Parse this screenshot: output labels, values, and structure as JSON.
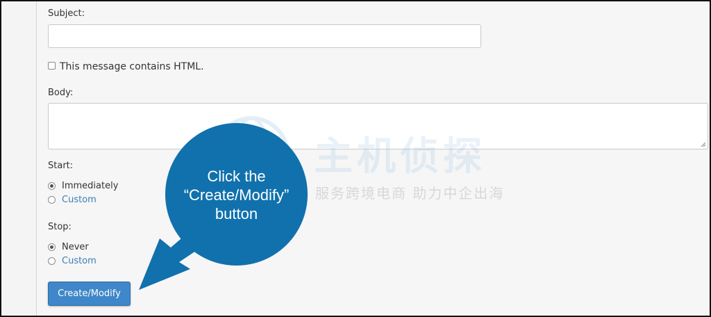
{
  "form": {
    "subject": {
      "label": "Subject:",
      "value": ""
    },
    "html_option": {
      "label": "This message contains HTML.",
      "checked": false
    },
    "body": {
      "label": "Body:",
      "value": ""
    },
    "start": {
      "label": "Start:",
      "options": [
        {
          "label": "Immediately",
          "selected": true
        },
        {
          "label": "Custom",
          "selected": false
        }
      ]
    },
    "stop": {
      "label": "Stop:",
      "options": [
        {
          "label": "Never",
          "selected": true
        },
        {
          "label": "Custom",
          "selected": false
        }
      ]
    },
    "submit_label": "Create/Modify"
  },
  "callout": {
    "lines": [
      "Click the",
      "“Create/Modify”",
      "button"
    ],
    "color": "#1071ad"
  },
  "watermark": {
    "title": "主机侦探",
    "subtitle": "服务跨境电商 助力中企出海"
  },
  "colors": {
    "button": "#3f87c8",
    "link": "#3c7db8",
    "background": "#f6f6f6"
  }
}
